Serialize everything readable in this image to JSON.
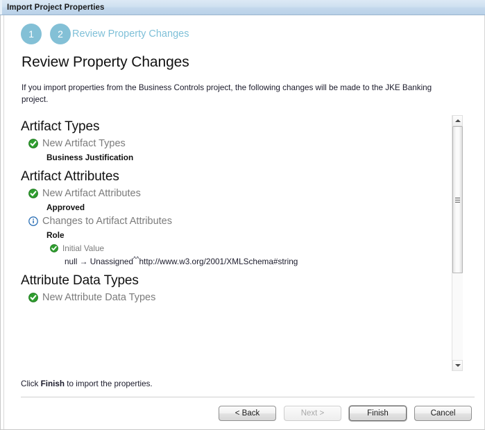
{
  "window": {
    "title": "Import Project Properties"
  },
  "wizard": {
    "steps": [
      {
        "number": "1",
        "label": ""
      },
      {
        "number": "2",
        "label": "Review Property Changes"
      }
    ],
    "page_title": "Review Property Changes",
    "intro": "If you import properties from the Business Controls project, the following changes will be made to the JKE Banking project."
  },
  "sections": [
    {
      "title": "Artifact Types",
      "groups": [
        {
          "icon": "check-circle-icon",
          "label": "New Artifact Types",
          "leaves": [
            {
              "name": "Business Justification"
            }
          ]
        }
      ]
    },
    {
      "title": "Artifact Attributes",
      "groups": [
        {
          "icon": "check-circle-icon",
          "label": "New Artifact Attributes",
          "leaves": [
            {
              "name": "Approved"
            }
          ]
        },
        {
          "icon": "info-circle-icon",
          "label": "Changes to Artifact Attributes",
          "leaves": [
            {
              "name": "Role",
              "sub_icon": "check-circle-icon",
              "sub_label": "Initial Value",
              "value_before": "null",
              "value_arrow": "→",
              "value_after": "Unassigned",
              "value_suffix_sup": "^^",
              "value_suffix": "http://www.w3.org/2001/XMLSchema#string"
            }
          ]
        }
      ]
    },
    {
      "title": "Attribute Data Types",
      "groups": [
        {
          "icon": "check-circle-icon",
          "label": "New Attribute Data Types",
          "leaves": []
        }
      ]
    }
  ],
  "footer": {
    "hint_prefix": "Click ",
    "hint_bold": "Finish",
    "hint_suffix": " to import the properties.",
    "buttons": {
      "back": "< Back",
      "next": "Next >",
      "finish": "Finish",
      "cancel": "Cancel"
    }
  },
  "scrollbar": {
    "up_icon": "arrow-up-icon",
    "down_icon": "arrow-down-icon",
    "thumb": "scroll-thumb"
  },
  "colors": {
    "step_circle": "#83c0d6",
    "step_link": "#7fc0d8",
    "title_bar": "#c3d8ec",
    "check_green": "#2f9e2f",
    "info_blue": "#2b6fb5",
    "group_label": "#7b7b7b"
  }
}
